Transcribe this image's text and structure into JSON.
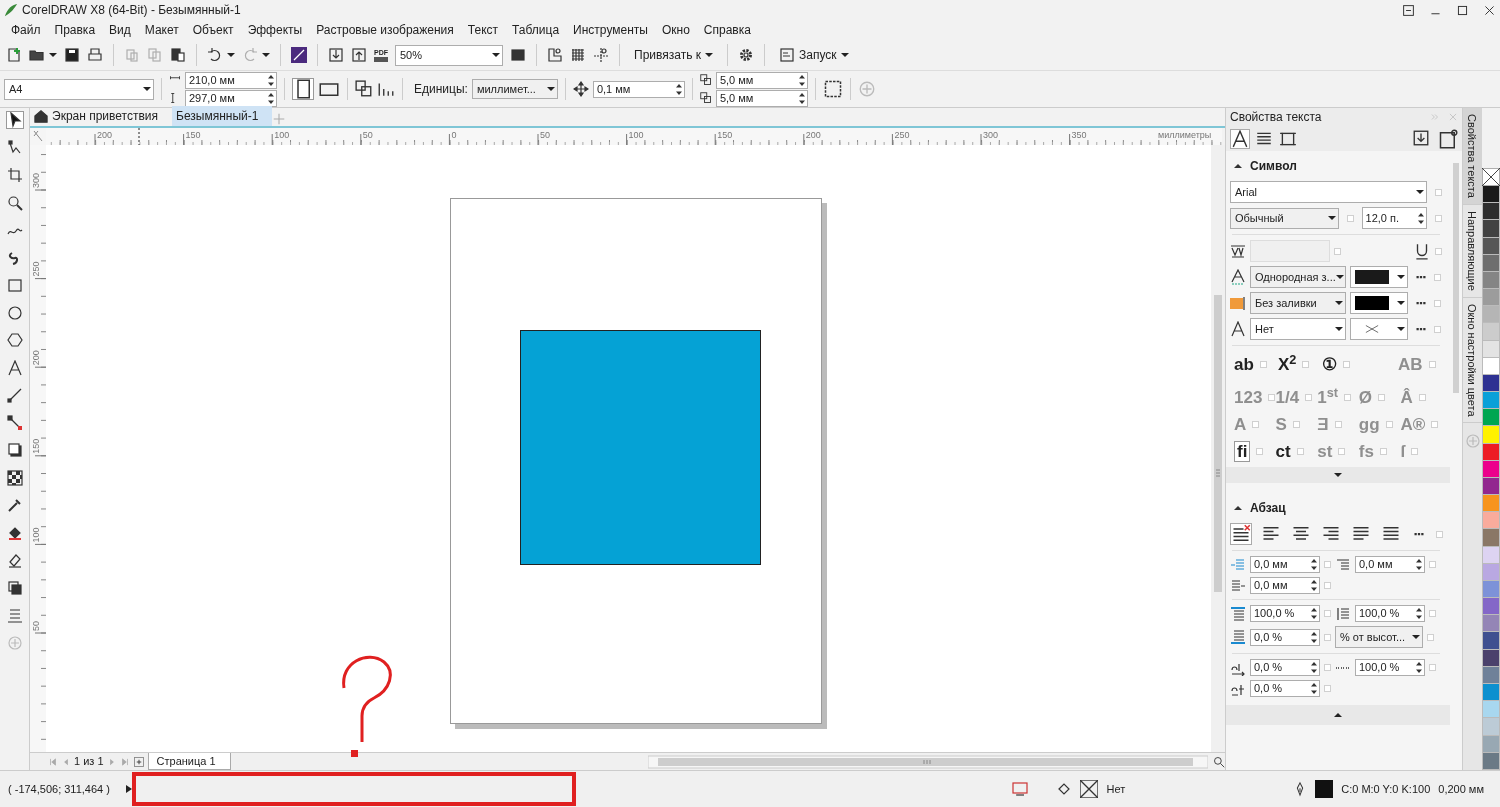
{
  "window": {
    "title": "CorelDRAW X8 (64-Bit) - Безымянный-1"
  },
  "menu": [
    {
      "label": "Файл"
    },
    {
      "label": "Правка"
    },
    {
      "label": "Вид"
    },
    {
      "label": "Макет"
    },
    {
      "label": "Объект"
    },
    {
      "label": "Эффекты"
    },
    {
      "label": "Растровые изображения"
    },
    {
      "label": "Текст"
    },
    {
      "label": "Таблица"
    },
    {
      "label": "Инструменты"
    },
    {
      "label": "Окно"
    },
    {
      "label": "Справка"
    }
  ],
  "toolbar": [
    {
      "kind": "new",
      "disabled": false,
      "menu": false
    },
    {
      "kind": "open",
      "disabled": false,
      "menu": true
    },
    {
      "kind": "save",
      "disabled": false,
      "menu": false
    },
    {
      "kind": "print",
      "disabled": false,
      "menu": false
    },
    {
      "kind": "separator"
    },
    {
      "kind": "cut",
      "disabled": true,
      "menu": false
    },
    {
      "kind": "copy",
      "disabled": true,
      "menu": false
    },
    {
      "kind": "paste",
      "disabled": false,
      "menu": false
    },
    {
      "kind": "separator"
    },
    {
      "kind": "undo",
      "disabled": false,
      "menu": true
    },
    {
      "kind": "redo",
      "disabled": true,
      "menu": true
    },
    {
      "kind": "separator"
    },
    {
      "kind": "app",
      "disabled": false,
      "menu": false
    },
    {
      "kind": "separator"
    },
    {
      "kind": "import",
      "disabled": false,
      "menu": false
    },
    {
      "kind": "export",
      "disabled": false,
      "menu": false
    },
    {
      "kind": "pdf",
      "label": "PDF"
    },
    {
      "kind": "combo",
      "value": "50%"
    },
    {
      "kind": "fullscreen",
      "disabled": false,
      "menu": false
    },
    {
      "kind": "separator"
    },
    {
      "kind": "rulers",
      "disabled": false,
      "menu": false
    },
    {
      "kind": "grid",
      "disabled": false,
      "menu": false
    },
    {
      "kind": "guides",
      "disabled": false,
      "menu": false
    },
    {
      "kind": "separator"
    },
    {
      "kind": "dropdown",
      "label": "Привязать к",
      "icon": false
    },
    {
      "kind": "separator"
    },
    {
      "kind": "gear",
      "disabled": false,
      "menu": false
    },
    {
      "kind": "separator"
    },
    {
      "kind": "dropdown",
      "label": "Запуск",
      "icon": true
    }
  ],
  "property_bar": {
    "page_size": "A4",
    "width": "210,0 мм",
    "height": "297,0 мм",
    "orientation": [
      {
        "selected": true
      },
      {
        "selected": false
      }
    ],
    "units_label": "Единицы:",
    "units": "миллимет...",
    "nudge": "0,1 мм",
    "duplicate_x": "5,0 мм",
    "duplicate_y": "5,0 мм"
  },
  "toolbox": [
    {
      "kind": "pick",
      "selected": true
    },
    {
      "kind": "shape",
      "selected": false
    },
    {
      "kind": "crop",
      "selected": false
    },
    {
      "kind": "zoom",
      "selected": false
    },
    {
      "kind": "freehand",
      "selected": false
    },
    {
      "kind": "artistic",
      "selected": false
    },
    {
      "kind": "rectangle",
      "selected": false
    },
    {
      "kind": "ellipse",
      "selected": false
    },
    {
      "kind": "polygon",
      "selected": false
    },
    {
      "kind": "text",
      "selected": false
    },
    {
      "kind": "dimension",
      "selected": false
    },
    {
      "kind": "connector",
      "selected": false
    },
    {
      "kind": "shadow",
      "selected": false
    },
    {
      "kind": "transparency",
      "selected": false
    },
    {
      "kind": "eyedropper",
      "selected": false
    },
    {
      "kind": "fill",
      "selected": false
    },
    {
      "kind": "smartfill",
      "selected": false
    },
    {
      "kind": "stack",
      "selected": false
    },
    {
      "kind": "list",
      "selected": false
    },
    {
      "kind": "add",
      "selected": false
    }
  ],
  "doc_tabs": [
    {
      "label": "Экран приветствия",
      "selected": false,
      "kind": "home"
    },
    {
      "label": "Безымянный-1",
      "selected": true,
      "kind": "document"
    }
  ],
  "ruler": {
    "x_labels": [
      "200",
      "150",
      "100",
      "50",
      "0",
      "50",
      "100",
      "150",
      "200",
      "250",
      "300",
      "350"
    ],
    "y_labels": [
      "300",
      "250",
      "200",
      "150",
      "100",
      "50"
    ],
    "unit": "миллиметры"
  },
  "shapes": [
    {
      "kind": "rectangle",
      "color": "#05a2d5"
    }
  ],
  "page_nav": {
    "page_info": "1 из 1",
    "pages": [
      {
        "label": "Страница 1",
        "selected": true
      }
    ]
  },
  "docker": {
    "title": "Свойства текста",
    "tabs": [
      {
        "selected": true
      },
      {
        "selected": false
      },
      {
        "selected": false
      }
    ],
    "option_boxes_checked": false,
    "sections": [
      {
        "title": "Символ",
        "expanded": true
      },
      {
        "title": "Абзац",
        "expanded": true
      }
    ],
    "font": "Arial",
    "style": "Обычный",
    "size": "12,0 п.",
    "fill_type": "Однородная з...",
    "background_fill": "Без заливки",
    "outline": "Нет",
    "opentype": [
      [
        {
          "label": "ab",
          "disabled": false
        },
        {
          "label": "X$^{2}$",
          "disabled": false
        },
        {
          "label": "①",
          "disabled": false
        },
        {
          "label": "AB",
          "disabled": true
        }
      ],
      [
        {
          "label": "123",
          "disabled": true
        },
        {
          "label": "1/4",
          "disabled": true
        },
        {
          "label": "1$^{st}$",
          "disabled": true
        },
        {
          "label": "Ø",
          "disabled": true
        },
        {
          "label": "Â",
          "disabled": true
        }
      ],
      [
        {
          "label": "A",
          "disabled": true
        },
        {
          "label": "S",
          "disabled": true
        },
        {
          "label": "Ǝ",
          "disabled": true
        },
        {
          "label": "gg",
          "disabled": true
        },
        {
          "label": "A®",
          "disabled": true
        }
      ],
      [
        {
          "label": "fi",
          "disabled": false
        },
        {
          "label": "ct",
          "disabled": false
        },
        {
          "label": "st",
          "disabled": true
        },
        {
          "label": "fs",
          "disabled": true
        },
        {
          "label": "ſ",
          "disabled": true
        }
      ]
    ],
    "alignment": [
      {
        "selected": true
      },
      {
        "selected": false
      },
      {
        "selected": false
      },
      {
        "selected": false
      },
      {
        "selected": false
      },
      {
        "selected": false
      }
    ],
    "paragraph_fields": [
      "0,0 мм",
      "0,0 мм",
      "0,0 мм",
      "100,0 %",
      "100,0 %",
      "0,0 %",
      "% от высот...",
      "0,0 %",
      "100,0 %",
      "0,0 %"
    ]
  },
  "docker_tabs": [
    {
      "label": "Свойства текста",
      "selected": true
    },
    {
      "label": "Направляющие",
      "selected": false
    },
    {
      "label": "Окно настройки цвета",
      "selected": false
    }
  ],
  "palette": [
    {
      "kind": "none"
    },
    {
      "color": "#1a1a1a"
    },
    {
      "color": "#2e2e2e"
    },
    {
      "color": "#424242"
    },
    {
      "color": "#575757"
    },
    {
      "color": "#6e6e6e"
    },
    {
      "color": "#858585"
    },
    {
      "color": "#9c9c9c"
    },
    {
      "color": "#b5b5b5"
    },
    {
      "color": "#cccccc"
    },
    {
      "color": "#e3e3e3"
    },
    {
      "color": "#ffffff"
    },
    {
      "color": "#2e3192"
    },
    {
      "color": "#0aa0d8"
    },
    {
      "color": "#00a651"
    },
    {
      "color": "#fff200"
    },
    {
      "color": "#ed1c24"
    },
    {
      "color": "#ec008c"
    },
    {
      "color": "#92278f"
    },
    {
      "color": "#f7941d"
    },
    {
      "color": "#f9ab9c"
    },
    {
      "color": "#8a7766"
    },
    {
      "color": "#ddd3f2"
    },
    {
      "color": "#b9a8e2"
    },
    {
      "color": "#7d92d8"
    },
    {
      "color": "#8467c8"
    },
    {
      "color": "#9485b6"
    },
    {
      "color": "#3f5090"
    },
    {
      "color": "#4b416c"
    },
    {
      "color": "#6f8199"
    },
    {
      "color": "#0c90cf"
    },
    {
      "color": "#a8d7ef"
    },
    {
      "color": "#bccbd6"
    },
    {
      "color": "#98a8b3"
    },
    {
      "color": "#6b7a86"
    }
  ],
  "status": {
    "coords": "( -174,506; 311,464 )",
    "fill": "Нет",
    "outline_color": "C:0 M:0 Y:0 K:100",
    "outline_width": "0,200 мм"
  }
}
